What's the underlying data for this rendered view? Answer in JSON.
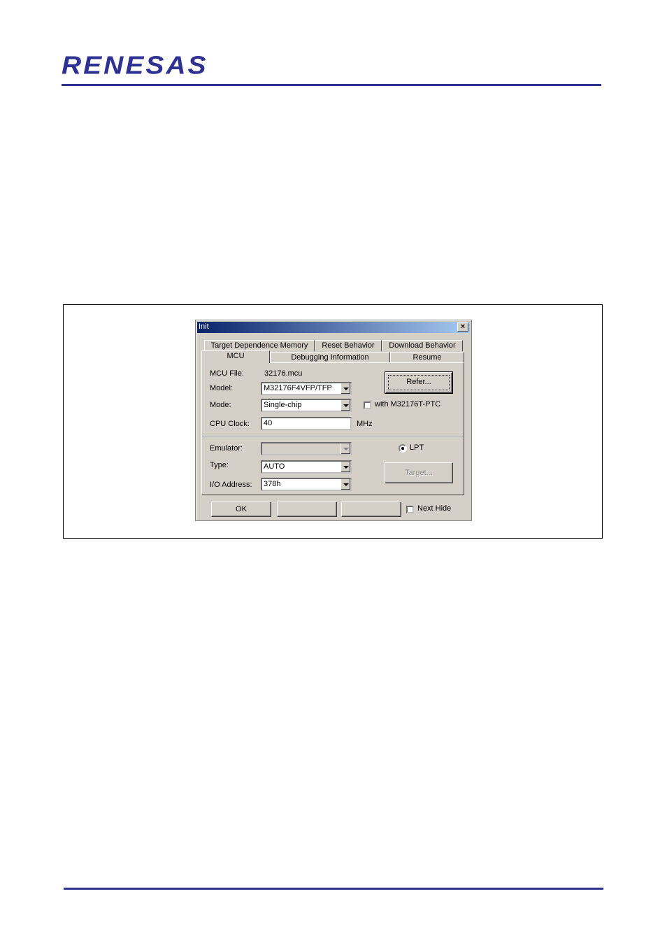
{
  "header": {
    "logo_text": "RENESAS"
  },
  "dialog": {
    "title": "Init",
    "close_glyph": "×",
    "tabs_row1": [
      "Target Dependence Memory",
      "Reset Behavior",
      "Download Behavior"
    ],
    "tabs_row2": [
      "MCU",
      "Debugging Information",
      "Resume"
    ],
    "mcu_file_label": "MCU File:",
    "mcu_file_value": "32176.mcu",
    "refer_label": "Refer...",
    "model_label": "Model:",
    "model_value": "M32176F4VFP/TFP",
    "mode_label": "Mode:",
    "mode_value": "Single-chip",
    "with_ptc_label": "with M32176T-PTC",
    "cpu_clock_label": "CPU Clock:",
    "cpu_clock_value": "40",
    "cpu_clock_unit": "MHz",
    "emulator_label": "Emulator:",
    "emulator_value": "",
    "lpt_label": "LPT",
    "type_label": "Type:",
    "type_value": "AUTO",
    "target_label": "Target...",
    "io_address_label": "I/O Address:",
    "io_address_value": "378h",
    "ok_label": "OK",
    "next_hide_label": "Next Hide"
  }
}
